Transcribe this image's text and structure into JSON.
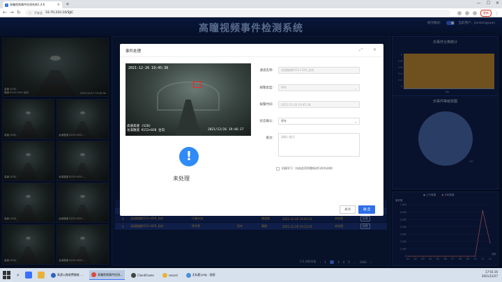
{
  "browser": {
    "tab_title": "高瞳视频事件检测系统1.4.6",
    "tab_close": "×",
    "new_tab": "+",
    "security_label": "不安全",
    "url": "33.70.210.10/SJJC",
    "update_label": "更新",
    "win_controls": [
      "—",
      "☐",
      "✕"
    ]
  },
  "app": {
    "title": "高瞳视频事件检测系统",
    "mode_label": "值守模式：",
    "user_label": "当前用户：jiankongyuan"
  },
  "video_captions": [
    "高速 (S20)  ",
    "龙溪隧道 K152+020 ..."
  ],
  "big_video": {
    "caption1": "高速 (S20)",
    "caption2": "隧道 K152+020 台向",
    "timestamp": "2021/12/27 15:45:58"
  },
  "modal": {
    "title": "事件处理",
    "snapshot": {
      "timestamp_top": "2021-12-26 19:45:38",
      "line1": "高速高速 (S20)",
      "line2": "龙溪隧道 K152+020 台向",
      "timestamp_bottom": "2021/12/26 19:46:17"
    },
    "status_icon": "!",
    "status_text": "未处理",
    "fields": {
      "location_label": "通道名称:",
      "location_value": "沈溪隧道K151+520_台向",
      "type_label": "报警类型:",
      "type_value": "停车",
      "time_label": "报警时间:",
      "time_value": "2021-12-26 19:45:38",
      "confirm_label": "状态确认:",
      "confirm_value": "停车",
      "remark_label": "备注:",
      "remark_placeholder": "请输入备注"
    },
    "checkbox_label": "机器学习（勾选此项则重新进行样本训练）",
    "cancel_label": "关闭",
    "ok_label": "确 定"
  },
  "table": {
    "rows": [
      {
        "idx": "2",
        "location": "沈溪隧道K151+370_台向",
        "type": "其他",
        "vehicle": "",
        "lane": "应A",
        "time": "2021-12-27 15:45:57",
        "status": "未处理",
        "action": "处理"
      },
      {
        "idx": "3",
        "location": "沈溪隧道K151+020_台向",
        "type": "停车等",
        "vehicle": "小车",
        "lane": "事故",
        "time": "2021-12-26 19:46:18",
        "status": "未处理",
        "action": "处理"
      },
      {
        "idx": "4",
        "location": "沈溪隧道K151+020_台向",
        "type": "行驶车流",
        "vehicle": "",
        "lane": "隧道路",
        "time": "2021-12-26 19:45:53",
        "status": "未处理",
        "action": "处理"
      },
      {
        "idx": "5",
        "location": "沈溪隧道K151+020_台向",
        "type": "停车等",
        "vehicle": "货车",
        "lane": "事故",
        "time": "2021-12-26 19:13:19",
        "status": "未处理",
        "action": "处理"
      }
    ],
    "pager": {
      "range": "1-5 共820条",
      "pages": [
        "1",
        "2",
        "3",
        "4",
        "5",
        "…",
        "1642"
      ]
    }
  },
  "right": {
    "panel1_title": "日事件分类统计",
    "panel1_category": "NA",
    "panel1_yticks": [
      "1",
      "0.8",
      "0.6",
      "0.4",
      "0.2",
      "0"
    ],
    "panel2_title": "日事件等级饼图",
    "panel2_label": "1/0",
    "panel3_legend": [
      "上午数据",
      "今年数据"
    ],
    "panel3_ylabel": "事件数",
    "panel3_xlabel": "月份",
    "panel3_yticks": [
      "7,000",
      "6,000",
      "5,000",
      "4,000",
      "3,000",
      "2,000",
      "1,000",
      "0"
    ],
    "panel3_xticks": [
      "01",
      "02",
      "03",
      "04",
      "05",
      "06",
      "07",
      "08",
      "09",
      "10",
      "11",
      "12"
    ]
  },
  "chart_data": {
    "type": "line",
    "x": [
      "01",
      "02",
      "03",
      "04",
      "05",
      "06",
      "07",
      "08",
      "09",
      "10",
      "11",
      "12"
    ],
    "series": [
      {
        "name": "今年数据",
        "values": [
          0,
          0,
          0,
          0,
          0,
          0,
          0,
          0,
          0,
          0,
          6200,
          1800
        ]
      }
    ],
    "ylabel": "事件数",
    "xlabel": "月份",
    "ylim": [
      0,
      7000
    ]
  },
  "taskbar": {
    "apps": [
      {
        "label": "高速公路收费稽查 ...",
        "active": false
      },
      {
        "label": "高瞳视频事件检测...",
        "active": true
      },
      {
        "label": "ClientFrame",
        "active": false
      },
      {
        "label": "record",
        "active": false
      },
      {
        "label": "无标题.png - 画图",
        "active": false
      }
    ],
    "time": "17:01:16",
    "date": "2021/12/27"
  },
  "colors": {
    "accent": "#2f6fe8",
    "warning_text": "#e6b94a",
    "bar_fill": "#c8943a"
  }
}
